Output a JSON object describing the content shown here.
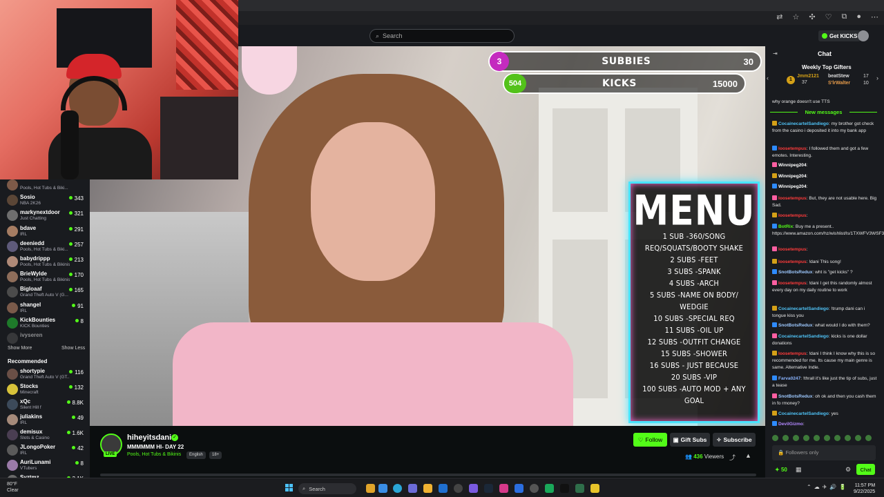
{
  "site_header": {
    "search_placeholder": "Search",
    "get_kicks_label": "Get KICKS"
  },
  "overlay": {
    "subbies": {
      "current": "3",
      "label": "SUBBIES",
      "target": "30"
    },
    "kicks": {
      "current": "504",
      "label": "KICKS",
      "target": "15000"
    },
    "menu": {
      "title": "MENU",
      "lines": [
        "1 SUB -360/SONG",
        "REQ/SQUATS/BOOTY SHAKE",
        "2 SUBS -FEET",
        "3 SUBS -SPANK",
        "4 SUBS -ARCH",
        "5 SUBS -NAME ON BODY/",
        "WEDGIE",
        "10 SUBS -SPECIAL REQ",
        "11 SUBS -OIL UP",
        "12 SUBS -OUTFIT CHANGE",
        "15 SUBS -SHOWER",
        "16 SUBS - JUST BECAUSE",
        "20 SUBS -VIP",
        "100 SUBS -AUTO MOD + ANY",
        "GOAL"
      ]
    }
  },
  "sidebar": {
    "following": [
      {
        "name": "",
        "category": "Pools, Hot Tubs & Biki...",
        "count": "",
        "color": "#7d5a48"
      },
      {
        "name": "Sosio",
        "category": "NBA 2K26",
        "count": "343",
        "color": "#5b4636"
      },
      {
        "name": "markynextdoor",
        "category": "Just Chatting",
        "count": "321",
        "color": "#6e6e6e"
      },
      {
        "name": "bdave",
        "category": "IRL",
        "count": "291",
        "color": "#a57c62"
      },
      {
        "name": "deeniedd",
        "category": "Pools, Hot Tubs & Biki...",
        "count": "257",
        "color": "#5e5a7a"
      },
      {
        "name": "babydrippp",
        "category": "Pools, Hot Tubs & Bikinis",
        "count": "213",
        "color": "#b08a78"
      },
      {
        "name": "BrieWylde",
        "category": "Pools, Hot Tubs & Bikinis",
        "count": "170",
        "color": "#8e6d5a"
      },
      {
        "name": "Bigloaaf",
        "category": "Grand Theft Auto V (G...",
        "count": "165",
        "color": "#4b4b4b"
      },
      {
        "name": "shangel",
        "category": "IRL",
        "count": "91",
        "color": "#7a5a4a"
      },
      {
        "name": "KickBounties",
        "category": "KICK Bounties",
        "count": "8",
        "color": "#1e7a2a"
      },
      {
        "name": "ivyseren",
        "category": "",
        "count": "",
        "color": "#555555"
      }
    ],
    "show_more": "Show More",
    "show_less": "Show Less",
    "recommended_title": "Recommended",
    "recommended": [
      {
        "name": "shortypie",
        "category": "Grand Theft Auto V (GT...",
        "count": "116",
        "color": "#6a4f46"
      },
      {
        "name": "Stocks",
        "category": "Minecraft",
        "count": "132",
        "color": "#d7c23a"
      },
      {
        "name": "xQc",
        "category": "Silent Hill f",
        "count": "8.8K",
        "color": "#3c4a5a"
      },
      {
        "name": "juliakins",
        "category": "IRL",
        "count": "49",
        "color": "#a58a7a"
      },
      {
        "name": "demisux",
        "category": "Slots & Casino",
        "count": "1.6K",
        "color": "#4a3e52"
      },
      {
        "name": "JLongoPoker",
        "category": "IRL",
        "count": "42",
        "color": "#5a5a5a"
      },
      {
        "name": "AuriLunami",
        "category": "VTubers",
        "count": "8",
        "color": "#9a7aa8"
      },
      {
        "name": "Syztmz",
        "category": "",
        "count": "3.1K",
        "color": "#6a6a6a"
      }
    ]
  },
  "stream": {
    "streamer": "hiheyitsdani",
    "title": "MMMMMM HI- DAY 22",
    "category": "Pools, Hot Tubs & Bikinis",
    "tags": [
      "English",
      "18+"
    ],
    "live_label": "LIVE",
    "follow_label": "Follow",
    "gift_subs_label": "Gift Subs",
    "subscribe_label": "Subscribe",
    "viewers": "436",
    "viewers_label": "Viewers"
  },
  "chat": {
    "title": "Chat",
    "top_gifters_title": "Weekly Top Gifters",
    "gifters": [
      {
        "name": "Jmm2121",
        "count": "37"
      },
      {
        "name": "beatStew",
        "count": "17"
      },
      {
        "name": "S'lrWalter",
        "count": "10"
      }
    ],
    "pre_message": "why orange doesn't use TTS",
    "new_messages_label": "New messages",
    "messages": [
      {
        "user": "CocainecartelSandiego",
        "color": "#4fc3f7",
        "text": "my brother got check from the casino i deposited it into my bank app"
      },
      {
        "user": "loosetempus",
        "color": "#ff3b3b",
        "text": "I followed them and got a few emotes. Interesting."
      },
      {
        "user": "Winnipeg204",
        "color": "#ffffff",
        "text": ""
      },
      {
        "user": "Winnipeg204",
        "color": "#ffffff",
        "text": ""
      },
      {
        "user": "Winnipeg204",
        "color": "#ffffff",
        "text": ""
      },
      {
        "user": "loosetempus",
        "color": "#ff3b3b",
        "text": "But, they are not usable here. Big Sad."
      },
      {
        "user": "loosetempus",
        "color": "#ff3b3b",
        "text": ""
      },
      {
        "user": "BotRix",
        "color": "#53fc18",
        "text": "Buy me a present.. https://www.amazon.com/hz/wishlist/ls/1TXWFV3WSF343/ref=nav_wishlist_lists_1"
      },
      {
        "user": "loosetempus",
        "color": "#ff3b3b",
        "text": ""
      },
      {
        "user": "loosetempus",
        "color": "#ff3b3b",
        "text": "!dani This song!"
      },
      {
        "user": "SnotBotsRedux",
        "color": "#9ec9ff",
        "text": "wht is \"get kicks\" ?"
      },
      {
        "user": "loosetempus",
        "color": "#ff3b3b",
        "text": "!dani I get this randomly almost every day on my daily routine to work"
      },
      {
        "user": "CocainecartelSandiego",
        "color": "#4fc3f7",
        "text": "!trump dani can i tongue kiss you"
      },
      {
        "user": "SnotBotsRedux",
        "color": "#9ec9ff",
        "text": "what would I do with them?"
      },
      {
        "user": "CocainecartelSandiego",
        "color": "#4fc3f7",
        "text": "kicks is one dollar donations"
      },
      {
        "user": "loosetempus",
        "color": "#ff3b3b",
        "text": "!dani I think I know why this is so recommended for me. Its cause my main genre is same. Alternative Indie."
      },
      {
        "user": "Farva0247",
        "color": "#8ab4ff",
        "text": "!thrall it's like just the tip of subs, just a tease"
      },
      {
        "user": "SnotBotsRedux",
        "color": "#9ec9ff",
        "text": "oh ok and then you cash them in fo rmoney?"
      },
      {
        "user": "CocainecartelSandiego",
        "color": "#4fc3f7",
        "text": "yes"
      },
      {
        "user": "DevilGizmo",
        "color": "#b388ff",
        "text": ""
      }
    ],
    "input_placeholder": "Followers only",
    "kicks_balance": "50",
    "send_label": "Chat"
  },
  "taskbar": {
    "weather_temp": "80°F",
    "weather_desc": "Clear",
    "search_label": "Search",
    "time": "11:57 PM",
    "date": "9/22/2025"
  }
}
